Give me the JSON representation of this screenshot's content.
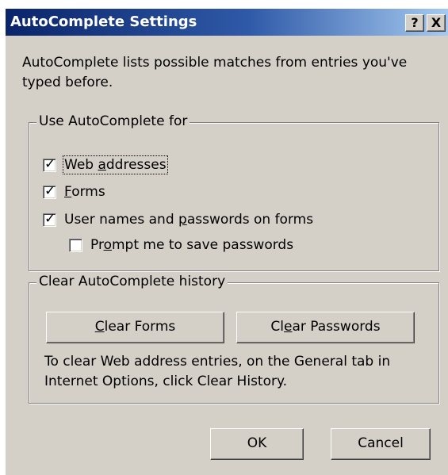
{
  "window": {
    "title": "AutoComplete Settings",
    "help_label": "?",
    "close_label": "X"
  },
  "intro_text": "AutoComplete lists possible matches from entries you've typed before.",
  "use_group": {
    "legend": "Use AutoComplete for",
    "items": [
      {
        "before": "Web ",
        "mnemonic": "a",
        "after": "ddresses",
        "checked": true
      },
      {
        "before": "",
        "mnemonic": "F",
        "after": "orms",
        "checked": true
      },
      {
        "before": "User names and ",
        "mnemonic": "p",
        "after": "asswords on forms",
        "checked": true
      },
      {
        "before": "Pr",
        "mnemonic": "o",
        "after": "mpt me to save passwords",
        "checked": false
      }
    ]
  },
  "clear_group": {
    "legend": "Clear AutoComplete history",
    "clear_forms": {
      "before": "",
      "mnemonic": "C",
      "after": "lear Forms"
    },
    "clear_passwords": {
      "before": "Cl",
      "mnemonic": "e",
      "after": "ar Passwords"
    },
    "info_text": "To clear Web address entries, on the General tab in Internet Options, click Clear History."
  },
  "footer": {
    "ok_label": "OK",
    "cancel_label": "Cancel"
  },
  "colors": {
    "face": "#d4d0c8",
    "title_start": "#0a246a",
    "title_end": "#a6caf0"
  }
}
